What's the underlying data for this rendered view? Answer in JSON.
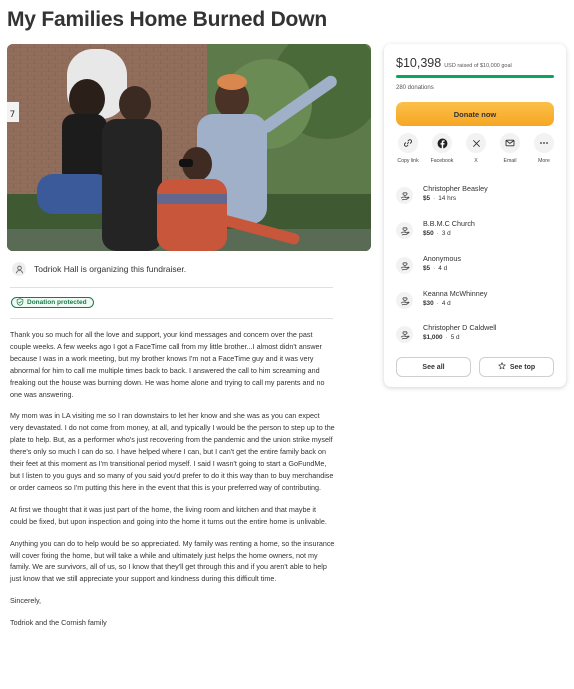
{
  "page": {
    "title": "My Families Home Burned Down"
  },
  "organizer": {
    "text": "Todriok Hall is organizing this fundraiser."
  },
  "badge": {
    "label": "Donation protected"
  },
  "story": {
    "paragraphs": [
      "Thank you so much for all the love and support, your kind messages and concern over the past couple weeks. A few weeks ago I got a FaceTime call from my little brother...I almost didn't answer because I was in a work meeting, but my brother knows I'm not a FaceTime guy and it was very abnormal for him to call me multiple times back to back. I answered the call to him screaming and freaking out the house was burning down. He was home alone and trying to call my parents and no one was answering.",
      "My mom was in LA visiting me so I ran downstairs to let her know and she was as you can expect very devastated. I do not come from money, at all, and typically I would be the person to step up to the plate to help. But, as a performer who's just recovering from the pandemic and the union strike myself there's only so much I can do so. I have helped where I can, but I can't get the entire family back on their feet at this moment as I'm transitional period myself. I said I wasn't going to start a GoFundMe, but I listen to you guys and so many of you said you'd prefer to do it this way than to buy merchandise or order cameos so I'm putting this here in the event that this is your preferred way of contributing.",
      "At first we thought that it was just part of the home, the living room and kitchen and that maybe it could be fixed, but upon inspection and going into the home it turns out the entire home is unlivable.",
      "Anything you can do to help would be so appreciated. My family was renting a home, so the insurance will cover fixing the home, but will take a while and ultimately just helps the home owners, not my family. We are survivors, all of us, so I know that they'll get through this and if you aren't able to help just know that we still appreciate your support and kindness during this difficult time.",
      "Sincerely,",
      "Todriok and the Cornish family"
    ]
  },
  "card": {
    "raised_amount": "$10,398",
    "raised_of": "USD raised of $10,000 goal",
    "progress_fraction": 1.0,
    "donations_count": "280 donations",
    "donate_label": "Donate now",
    "share": [
      {
        "icon": "link-icon",
        "label": "Copy link"
      },
      {
        "icon": "facebook-icon",
        "label": "Facebook"
      },
      {
        "icon": "x-icon",
        "label": "X"
      },
      {
        "icon": "email-icon",
        "label": "Email"
      },
      {
        "icon": "more-icon",
        "label": "More"
      }
    ],
    "donors": [
      {
        "name": "Christopher Beasley",
        "amount": "$5",
        "time": "14 hrs"
      },
      {
        "name": "B.B.M.C Church",
        "amount": "$50",
        "time": "3 d"
      },
      {
        "name": "Anonymous",
        "amount": "$5",
        "time": "4 d"
      },
      {
        "name": "Keanna McWhinney",
        "amount": "$30",
        "time": "4 d"
      },
      {
        "name": "Christopher D Caldwell",
        "amount": "$1,000",
        "time": "5 d"
      }
    ],
    "see_all_label": "See all",
    "see_top_label": "See top"
  },
  "colors": {
    "accent_green": "#02a95c",
    "donate_yellow": "#f9b22a"
  }
}
